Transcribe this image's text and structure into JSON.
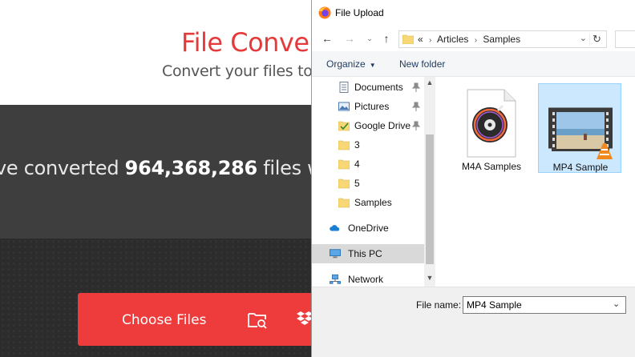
{
  "site": {
    "title": "File Convert",
    "subtitle": "Convert your files to any",
    "stats_prefix": "ve converted ",
    "stats_count": "964,368,286",
    "stats_suffix": " files wi",
    "choose_files_label": "Choose Files",
    "icons": [
      "folder-search-icon",
      "dropbox-icon"
    ],
    "colors": {
      "brand_red": "#ee3b3b",
      "dark_band": "#3e3e3e"
    }
  },
  "dialog": {
    "title": "File Upload",
    "address": {
      "overflow": "«",
      "crumbs": [
        "Articles",
        "Samples"
      ]
    },
    "toolbar": {
      "organize_label": "Organize",
      "new_folder_label": "New folder"
    },
    "nav_pane": {
      "items": [
        {
          "label": "Documents",
          "icon": "documents-icon",
          "pinned": true
        },
        {
          "label": "Pictures",
          "icon": "pictures-icon",
          "pinned": true
        },
        {
          "label": "Google Drive",
          "icon": "google-drive-folder-icon",
          "pinned": true
        },
        {
          "label": "3",
          "icon": "folder-icon",
          "pinned": false
        },
        {
          "label": "4",
          "icon": "folder-icon",
          "pinned": false
        },
        {
          "label": "5",
          "icon": "folder-icon",
          "pinned": false
        },
        {
          "label": "Samples",
          "icon": "folder-icon",
          "pinned": false
        },
        {
          "label": "OneDrive",
          "icon": "onedrive-icon",
          "pinned": false
        },
        {
          "label": "This PC",
          "icon": "this-pc-icon",
          "pinned": false,
          "selected": true
        },
        {
          "label": "Network",
          "icon": "network-icon",
          "pinned": false
        }
      ]
    },
    "files": [
      {
        "name": "M4A Samples",
        "icon": "audio-file-icon",
        "selected": false
      },
      {
        "name": "MP4 Sample",
        "icon": "video-file-icon",
        "selected": true
      }
    ],
    "footer": {
      "file_name_label": "File name:",
      "file_name_value": "MP4 Sample"
    },
    "colors": {
      "selection": "#cce8ff",
      "selection_border": "#99d1ff"
    }
  }
}
